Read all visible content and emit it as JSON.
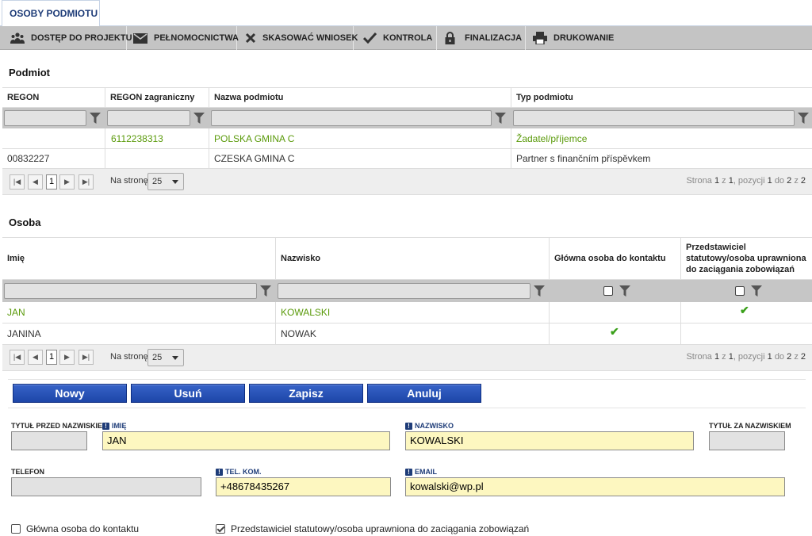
{
  "tab_title": "OSOBY PODMIOTU",
  "toolbar": {
    "items": [
      {
        "label": "DOSTĘP DO PROJEKTU",
        "icon": "people-icon"
      },
      {
        "label": "PEŁNOMOCNICTWA",
        "icon": "envelope-icon"
      },
      {
        "label": "SKASOWAĆ WNIOSEK",
        "icon": "x-icon"
      },
      {
        "label": "KONTROLA",
        "icon": "checkmark-icon"
      },
      {
        "label": "FINALIZACJA",
        "icon": "lock-icon"
      },
      {
        "label": "DRUKOWANIE",
        "icon": "printer-icon"
      }
    ]
  },
  "podmiot": {
    "title": "Podmiot",
    "columns": [
      "REGON",
      "REGON zagraniczny",
      "Nazwa podmiotu",
      "Typ podmiotu"
    ],
    "rows": [
      {
        "regon": "",
        "regon_zagr": "6112238313",
        "nazwa": "POLSKA GMINA C",
        "typ": "Žadatel/příjemce",
        "selected": true
      },
      {
        "regon": "00832227",
        "regon_zagr": "",
        "nazwa": "CZESKA GMINA C",
        "typ": "Partner s finančním příspěvkem",
        "selected": false
      }
    ],
    "pager": {
      "page": "1",
      "per_page_label": "Na stronę",
      "per_page": "25",
      "info_strona": "Strona",
      "info_page": "1",
      "info_z1": "z",
      "info_pages": "1",
      "info_poz": ", pozycji",
      "info_from": "1",
      "info_do": "do",
      "info_to": "2",
      "info_z2": "z",
      "info_total": "2"
    }
  },
  "osoba": {
    "title": "Osoba",
    "columns": [
      "Imię",
      "Nazwisko",
      "Główna osoba do kontaktu",
      "Przedstawiciel statutowy/osoba uprawniona do zaciągania zobowiązań"
    ],
    "rows": [
      {
        "imie": "JAN",
        "nazwisko": "KOWALSKI",
        "glowna": false,
        "przedstawiciel": true,
        "selected": true
      },
      {
        "imie": "JANINA",
        "nazwisko": "NOWAK",
        "glowna": true,
        "przedstawiciel": false,
        "selected": false
      }
    ],
    "pager": {
      "page": "1",
      "per_page_label": "Na stronę",
      "per_page": "25",
      "info_strona": "Strona",
      "info_page": "1",
      "info_z1": "z",
      "info_pages": "1",
      "info_poz": ", pozycji",
      "info_from": "1",
      "info_do": "do",
      "info_to": "2",
      "info_z2": "z",
      "info_total": "2"
    }
  },
  "actions": {
    "new": "Nowy",
    "delete": "Usuń",
    "save": "Zapisz",
    "cancel": "Anuluj"
  },
  "form": {
    "tytul_przed": {
      "label": "TYTUŁ PRZED NAZWISKIEM",
      "value": ""
    },
    "imie": {
      "label": "IMIĘ",
      "value": "JAN"
    },
    "nazwisko": {
      "label": "NAZWISKO",
      "value": "KOWALSKI"
    },
    "tytul_za": {
      "label": "TYTUŁ ZA NAZWISKIEM",
      "value": ""
    },
    "telefon": {
      "label": "TELEFON",
      "value": ""
    },
    "tel_kom": {
      "label": "TEL. KOM.",
      "value": "+48678435267"
    },
    "email": {
      "label": "EMAIL",
      "value": "kowalski@wp.pl"
    },
    "glowna_cb": {
      "label": "Główna osoba do kontaktu",
      "checked": false
    },
    "przedstawiciel_cb": {
      "label": "Przedstawiciel statutowy/osoba uprawniona do zaciągania zobowiązań",
      "checked": true
    }
  },
  "colors": {
    "accent": "#1e3c78",
    "selected_text": "#5a9a0a",
    "required_bg": "#fdf7c0",
    "button": "#2b55b8"
  }
}
